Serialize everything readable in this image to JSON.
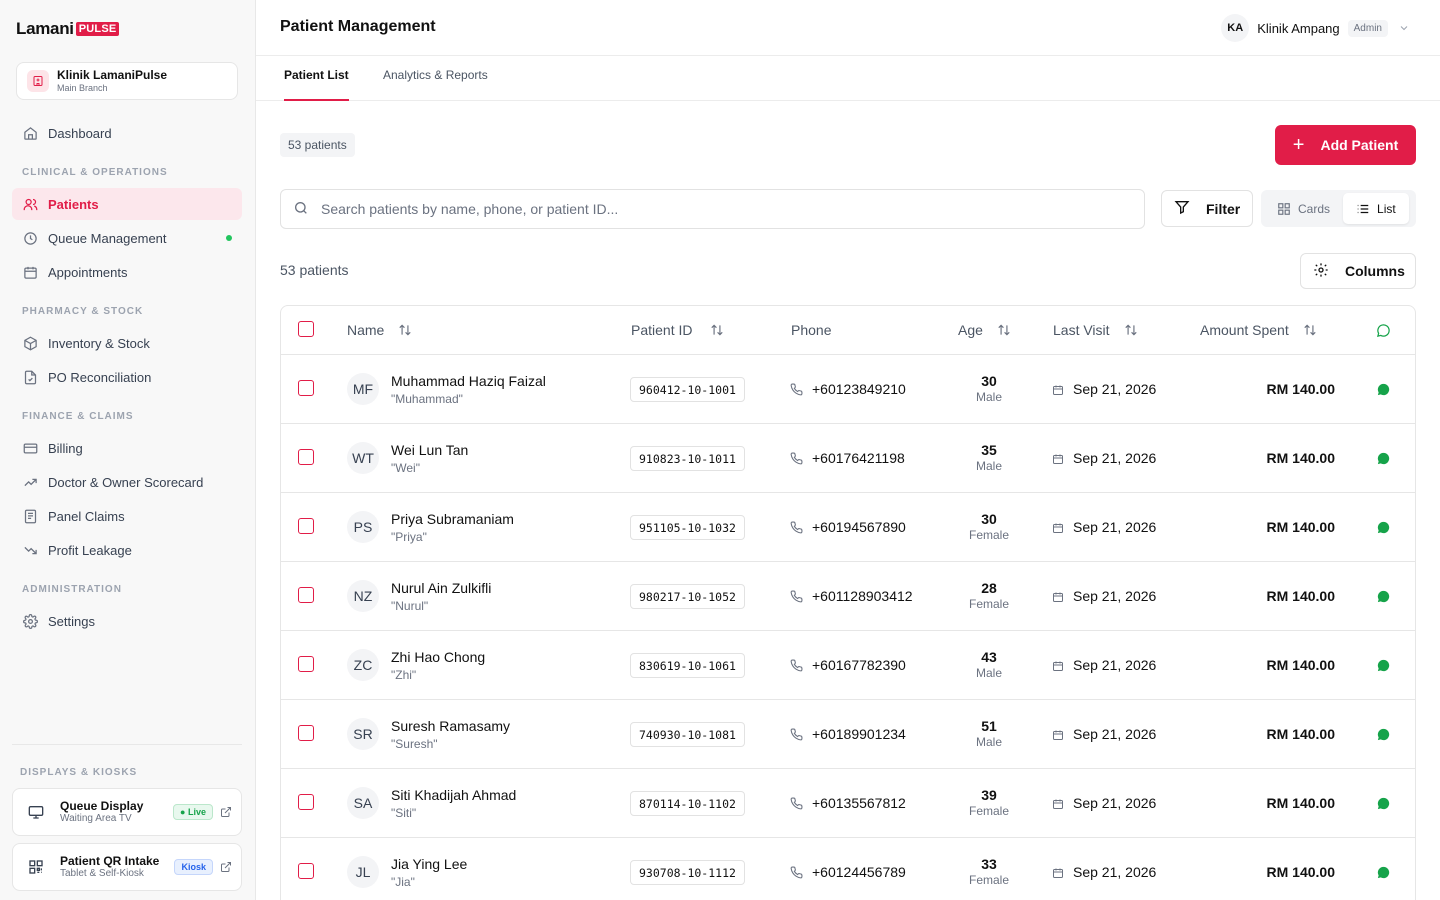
{
  "brand": {
    "word": "Lamani",
    "tag": "PULSE"
  },
  "clinic": {
    "name": "Klinik LamaniPulse",
    "branch": "Main Branch"
  },
  "nav": {
    "dashboard": "Dashboard",
    "sections": {
      "clinical": "CLINICAL & OPERATIONS",
      "pharmacy": "PHARMACY & STOCK",
      "finance": "FINANCE & CLAIMS",
      "admin": "ADMINISTRATION",
      "displays": "DISPLAYS & KIOSKS"
    },
    "patients": "Patients",
    "queue": "Queue Management",
    "appointments": "Appointments",
    "inventory": "Inventory & Stock",
    "po": "PO Reconciliation",
    "billing": "Billing",
    "scorecard": "Doctor & Owner Scorecard",
    "panel": "Panel Claims",
    "leakage": "Profit Leakage",
    "settings": "Settings"
  },
  "kiosks": [
    {
      "title": "Queue Display",
      "sub": "Waiting Area TV",
      "badge": "Live"
    },
    {
      "title": "Patient QR Intake",
      "sub": "Tablet & Self-Kiosk",
      "badge": "Kiosk"
    }
  ],
  "header": {
    "title": "Patient Management",
    "user_initials": "KA",
    "user_name": "Klinik Ampang",
    "role": "Admin"
  },
  "tabs": [
    "Patient List",
    "Analytics & Reports"
  ],
  "toolbar": {
    "count_chip": "53 patients",
    "add_label": "Add Patient",
    "search_placeholder": "Search patients by name, phone, or patient ID...",
    "filter_label": "Filter",
    "view_cards": "Cards",
    "view_list": "List",
    "patients_count": "53 patients",
    "columns_label": "Columns"
  },
  "table": {
    "headers": {
      "name": "Name",
      "pid": "Patient ID",
      "phone": "Phone",
      "age": "Age",
      "last_visit": "Last Visit",
      "amount": "Amount Spent"
    },
    "rows": [
      {
        "initials": "MF",
        "name": "Muhammad Haziq Faizal",
        "nick": "\"Muhammad\"",
        "pid": "960412-10-1001",
        "phone": "+60123849210",
        "age": "30",
        "gender": "Male",
        "visit": "Sep 21, 2026",
        "amount": "RM 140.00"
      },
      {
        "initials": "WT",
        "name": "Wei Lun Tan",
        "nick": "\"Wei\"",
        "pid": "910823-10-1011",
        "phone": "+60176421198",
        "age": "35",
        "gender": "Male",
        "visit": "Sep 21, 2026",
        "amount": "RM 140.00"
      },
      {
        "initials": "PS",
        "name": "Priya Subramaniam",
        "nick": "\"Priya\"",
        "pid": "951105-10-1032",
        "phone": "+60194567890",
        "age": "30",
        "gender": "Female",
        "visit": "Sep 21, 2026",
        "amount": "RM 140.00"
      },
      {
        "initials": "NZ",
        "name": "Nurul Ain Zulkifli",
        "nick": "\"Nurul\"",
        "pid": "980217-10-1052",
        "phone": "+601128903412",
        "age": "28",
        "gender": "Female",
        "visit": "Sep 21, 2026",
        "amount": "RM 140.00"
      },
      {
        "initials": "ZC",
        "name": "Zhi Hao Chong",
        "nick": "\"Zhi\"",
        "pid": "830619-10-1061",
        "phone": "+60167782390",
        "age": "43",
        "gender": "Male",
        "visit": "Sep 21, 2026",
        "amount": "RM 140.00"
      },
      {
        "initials": "SR",
        "name": "Suresh Ramasamy",
        "nick": "\"Suresh\"",
        "pid": "740930-10-1081",
        "phone": "+60189901234",
        "age": "51",
        "gender": "Male",
        "visit": "Sep 21, 2026",
        "amount": "RM 140.00"
      },
      {
        "initials": "SA",
        "name": "Siti Khadijah Ahmad",
        "nick": "\"Siti\"",
        "pid": "870114-10-1102",
        "phone": "+60135567812",
        "age": "39",
        "gender": "Female",
        "visit": "Sep 21, 2026",
        "amount": "RM 140.00"
      },
      {
        "initials": "JL",
        "name": "Jia Ying Lee",
        "nick": "\"Jia\"",
        "pid": "930708-10-1112",
        "phone": "+60124456789",
        "age": "33",
        "gender": "Female",
        "visit": "Sep 21, 2026",
        "amount": "RM 140.00"
      }
    ]
  },
  "colors": {
    "accent": "#e11d48",
    "whatsapp": "#16a34a",
    "live": "#22c55e"
  }
}
